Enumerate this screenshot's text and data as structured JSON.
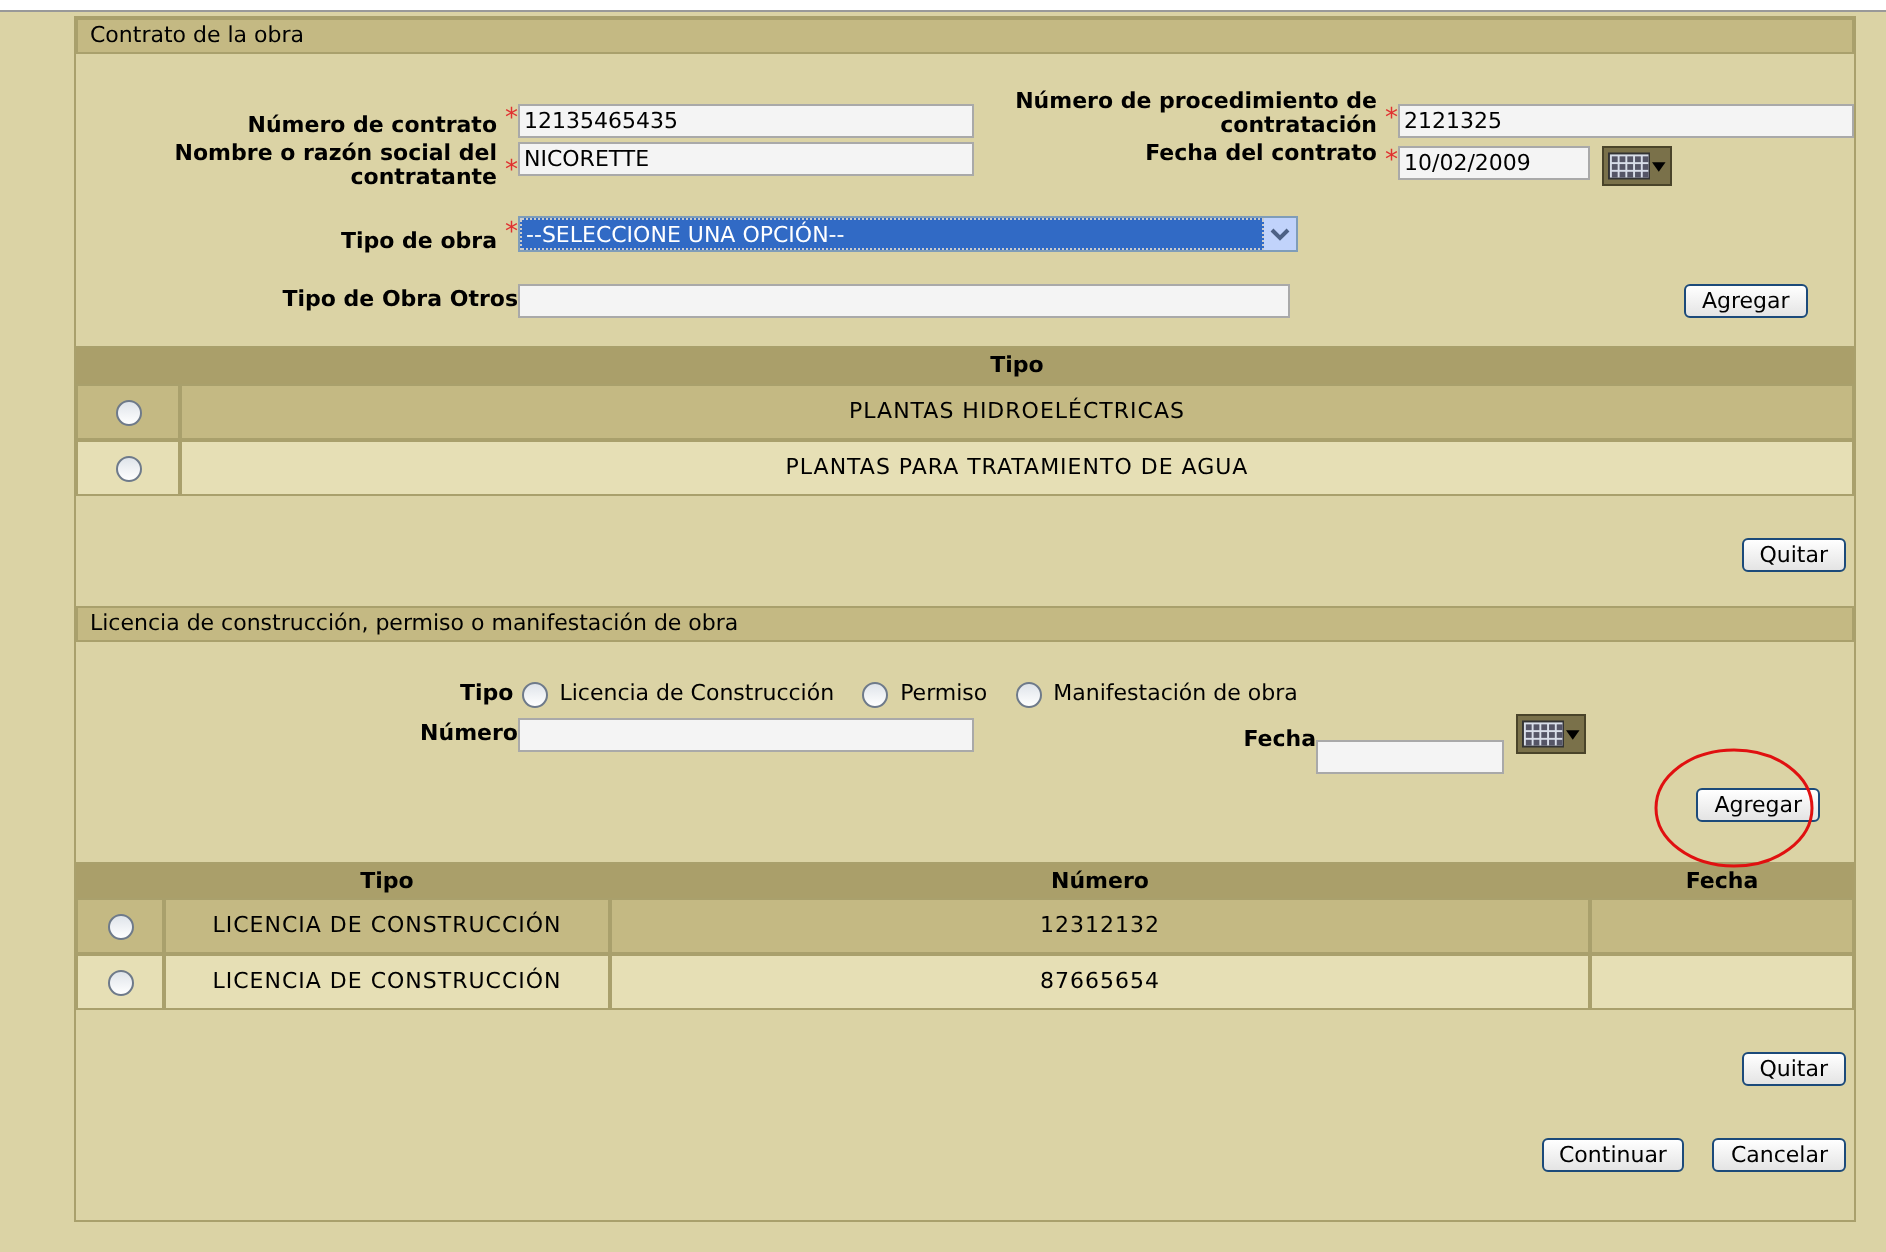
{
  "contract_section": {
    "title": "Contrato de la obra",
    "contract_number": {
      "label": "Número de contrato",
      "required_mark": "*",
      "value": "12135465435"
    },
    "procedure_number": {
      "label": "Número de procedimiento de contratación",
      "required_mark": "*",
      "value": "2121325"
    },
    "contractor_name": {
      "label": "Nombre o razón social del contratante",
      "required_mark": "*",
      "value": "NICORETTE"
    },
    "contract_date": {
      "label": "Fecha del contrato",
      "required_mark": "*",
      "value": "10/02/2009"
    },
    "work_type": {
      "label": "Tipo de obra",
      "required_mark": "*",
      "value": "--SELECCIONE UNA OPCIÓN--"
    },
    "other_type": {
      "label": "Tipo de Obra Otros"
    },
    "add_button": "Agregar",
    "table": {
      "columns": [
        "Tipo"
      ],
      "rows": [
        {
          "selected": false,
          "cells": [
            "PLANTAS HIDROELÉCTRICAS"
          ]
        },
        {
          "selected": false,
          "cells": [
            "PLANTAS PARA TRATAMIENTO DE AGUA"
          ]
        }
      ]
    },
    "remove_button": "Quitar"
  },
  "license_section": {
    "title": "Licencia de construcción, permiso o manifestación de obra",
    "type_label": "Tipo",
    "type_options": [
      {
        "label": "Licencia de Construcción",
        "selected": false
      },
      {
        "label": "Permiso",
        "selected": false
      },
      {
        "label": "Manifestación de obra",
        "selected": false
      }
    ],
    "number_label": "Número",
    "date_label": "Fecha",
    "add_button": "Agregar",
    "table": {
      "columns": [
        "Tipo",
        "Número",
        "Fecha"
      ],
      "rows": [
        {
          "selected": false,
          "cells": [
            "LICENCIA DE CONSTRUCCIÓN",
            "12312132"
          ]
        },
        {
          "selected": false,
          "cells": [
            "LICENCIA DE CONSTRUCCIÓN",
            "87665654"
          ]
        }
      ]
    },
    "remove_button": "Quitar"
  },
  "buttons": [
    "Continuar",
    "Cancelar"
  ]
}
